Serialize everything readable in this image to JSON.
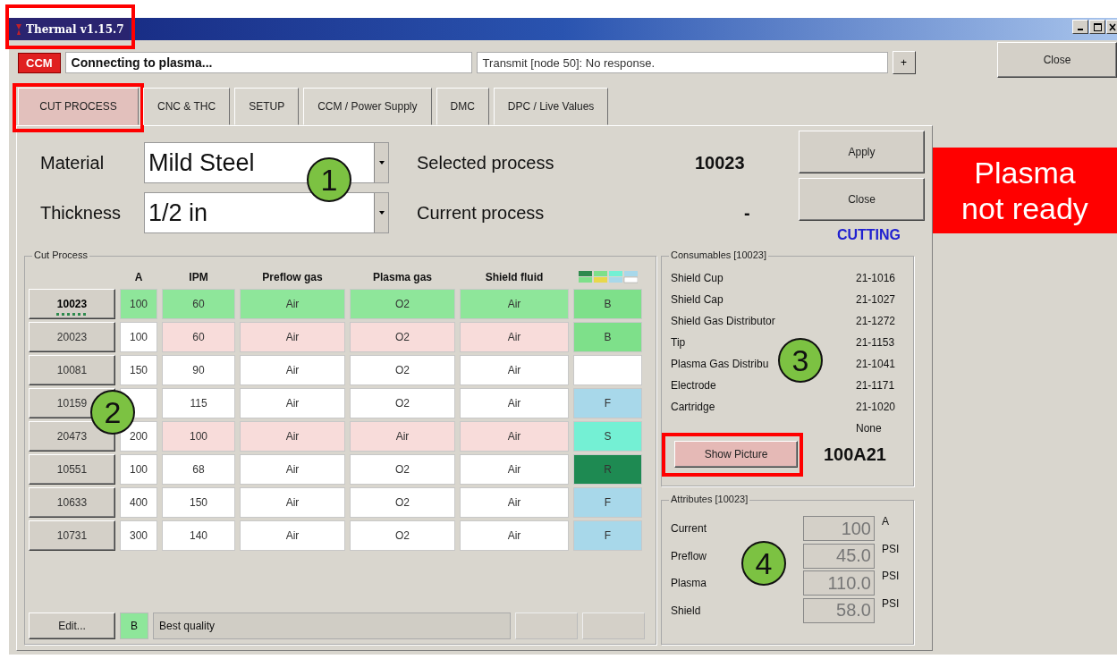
{
  "window": {
    "title": "Thermal v1.15.7",
    "highlighted": true
  },
  "status_bar": {
    "badge": "CCM",
    "message": "Connecting to plasma...",
    "transmit": "Transmit [node 50]: No response.",
    "plus_button": "+"
  },
  "close_button": "Close",
  "tabs": [
    {
      "label": "CUT PROCESS",
      "selected": true,
      "highlighted": true
    },
    {
      "label": "CNC & THC",
      "selected": false,
      "highlighted": false
    },
    {
      "label": "SETUP",
      "selected": false,
      "highlighted": false
    },
    {
      "label": "CCM / Power Supply",
      "selected": false,
      "highlighted": false
    },
    {
      "label": "DMC",
      "selected": false,
      "highlighted": false
    },
    {
      "label": "DPC / Live Values",
      "selected": false,
      "highlighted": false
    }
  ],
  "process_form": {
    "material_label": "Material",
    "material": "Mild Steel",
    "thickness_label": "Thickness",
    "thickness": "1/2 in",
    "selected_label": "Selected process",
    "selected_value": "10023",
    "current_label": "Current process",
    "current_value": "-"
  },
  "apply_button": "Apply",
  "panel_close_button": "Close",
  "mode": "CUTTING",
  "plasma_status": "Plasma not ready",
  "cut_process": {
    "title": "Cut Process",
    "columns": [
      "A",
      "IPM",
      "Preflow gas",
      "Plasma gas",
      "Shield fluid"
    ],
    "rows": [
      {
        "id": "10023",
        "amps": "100",
        "ipm": "60",
        "preflow": "Air",
        "plasma": "O2",
        "shield": "Air",
        "quality": "B",
        "color": "#7ee08a",
        "selected": true,
        "mismatch": false
      },
      {
        "id": "20023",
        "amps": "100",
        "ipm": "60",
        "preflow": "Air",
        "plasma": "O2",
        "shield": "Air",
        "quality": "B",
        "color": "#7ee08a",
        "selected": false,
        "mismatch": true
      },
      {
        "id": "10081",
        "amps": "150",
        "ipm": "90",
        "preflow": "Air",
        "plasma": "O2",
        "shield": "Air",
        "color": "#ffffff",
        "selected": false,
        "mismatch": false
      },
      {
        "id": "10159",
        "ipm": "115",
        "preflow": "Air",
        "plasma": "O2",
        "shield": "Air",
        "quality": "F",
        "color": "#a8d8ea",
        "selected": false,
        "mismatch": false
      },
      {
        "id": "20473",
        "amps": "200",
        "ipm": "100",
        "preflow": "Air",
        "plasma": "Air",
        "shield": "Air",
        "quality": "S",
        "color": "#74f0d4",
        "selected": false,
        "mismatch": true
      },
      {
        "id": "10551",
        "amps": "100",
        "ipm": "68",
        "preflow": "Air",
        "plasma": "O2",
        "shield": "Air",
        "quality": "R",
        "color": "#1e8a52",
        "selected": false,
        "mismatch": false
      },
      {
        "id": "10633",
        "amps": "400",
        "ipm": "150",
        "preflow": "Air",
        "plasma": "O2",
        "shield": "Air",
        "quality": "F",
        "color": "#a8d8ea",
        "selected": false,
        "mismatch": false
      },
      {
        "id": "10731",
        "amps": "300",
        "ipm": "140",
        "preflow": "Air",
        "plasma": "O2",
        "shield": "Air",
        "quality": "F",
        "color": "#a8d8ea",
        "selected": false,
        "mismatch": false
      }
    ],
    "edit_button": "Edit...",
    "quality_badge": "B",
    "quality_text": "Best quality",
    "nav_buttons": [
      {
        "disabled": true
      },
      {
        "disabled": true
      }
    ]
  },
  "consumables": {
    "title": "Consumables [10023]",
    "items": [
      {
        "name": "Shield Cup",
        "part": "21-1016"
      },
      {
        "name": "Shield Cap",
        "part": "21-1027"
      },
      {
        "name": "Shield Gas Distributor",
        "part": "21-1272"
      },
      {
        "name": "Tip",
        "part": "21-1153"
      },
      {
        "name": "Plasma Gas Distribu",
        "part": "21-1041"
      },
      {
        "name": "Electrode",
        "part": "21-1171"
      },
      {
        "name": "Cartridge",
        "part": "21-1020"
      },
      {
        "part": "None"
      }
    ],
    "show_picture": {
      "label": "Show Picture",
      "highlighted": true
    },
    "torch_code": "100A21"
  },
  "attributes": {
    "title": "Attributes [10023]",
    "items": [
      {
        "label": "Current",
        "value": "100",
        "unit": "A"
      },
      {
        "label": "Preflow",
        "value": "45.0",
        "unit": "PSI"
      },
      {
        "label": "Plasma",
        "value": "110.0",
        "unit": "PSI"
      },
      {
        "label": "Shield",
        "value": "58.0",
        "unit": "PSI"
      }
    ]
  },
  "callouts": [
    {
      "number": "1"
    },
    {
      "number": "2"
    },
    {
      "number": "3"
    },
    {
      "number": "4"
    }
  ]
}
